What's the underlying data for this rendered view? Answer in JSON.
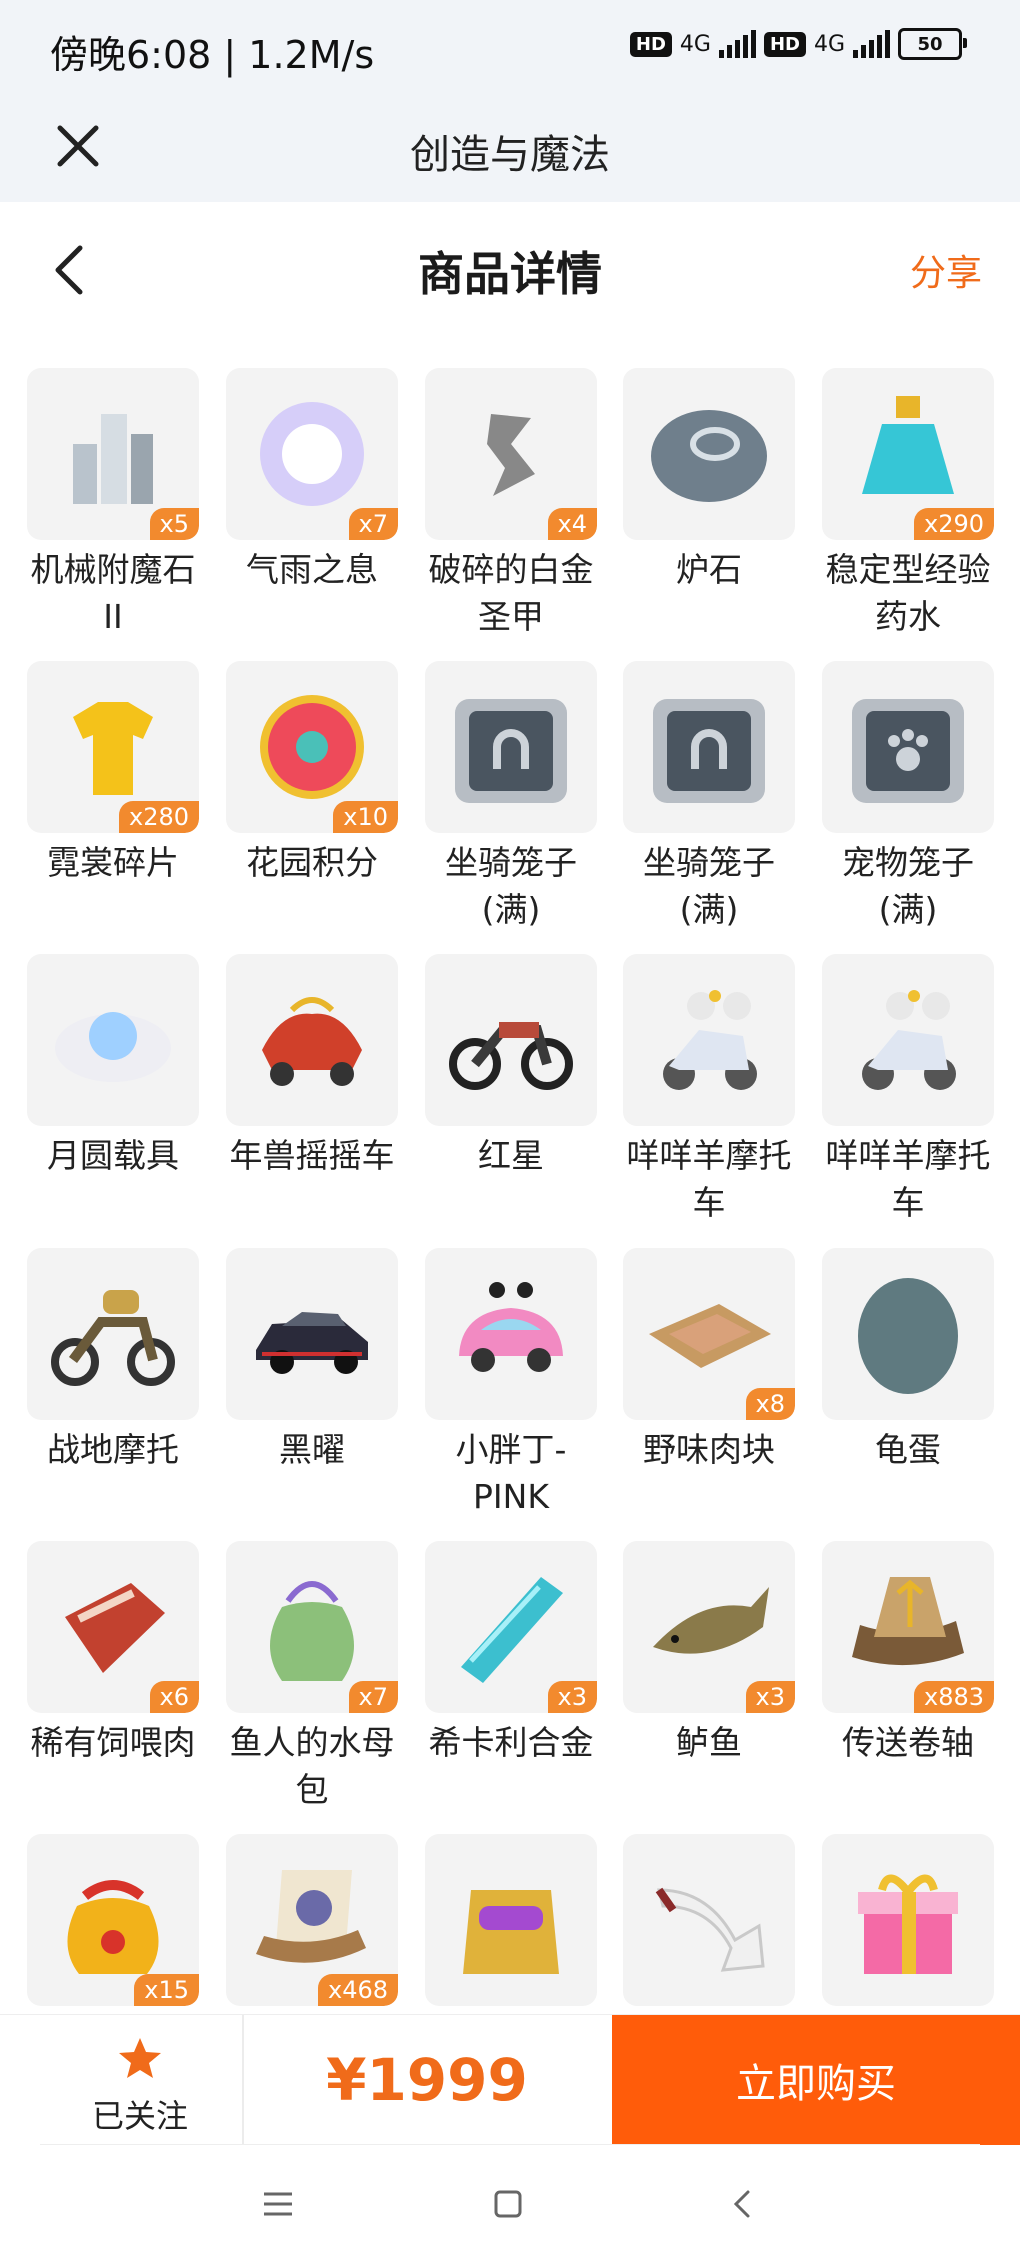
{
  "status": {
    "time": "傍晚6:08 | 1.2M/s",
    "network1": "4G",
    "network2": "4G",
    "battery": "50",
    "hd": "HD"
  },
  "appbar": {
    "title": "创造与魔法"
  },
  "page": {
    "title": "商品详情",
    "share": "分享"
  },
  "items": [
    {
      "name": "机械附魔石II",
      "count": "x5",
      "icon": "crystal-icon",
      "color": "#b9c3cc"
    },
    {
      "name": "气雨之息",
      "count": "x7",
      "icon": "orb-icon",
      "color": "#b9a9ff"
    },
    {
      "name": "破碎的白金圣甲",
      "count": "x4",
      "icon": "fragment-icon",
      "color": "#888888"
    },
    {
      "name": "炉石",
      "count": "",
      "icon": "stone-icon",
      "color": "#6f7f8c"
    },
    {
      "name": "稳定型经验药水",
      "count": "x290",
      "icon": "potion-icon",
      "color": "#36c6d6"
    },
    {
      "name": "霓裳碎片",
      "count": "x280",
      "icon": "shirt-icon",
      "color": "#f4c21a"
    },
    {
      "name": "花园积分",
      "count": "x10",
      "icon": "flower-icon",
      "color": "#ee4a5a"
    },
    {
      "name": "坐骑笼子(满)",
      "count": "",
      "icon": "mount-cage-icon",
      "color": "#4a5560"
    },
    {
      "name": "坐骑笼子(满)",
      "count": "",
      "icon": "mount-cage-icon",
      "color": "#4a5560"
    },
    {
      "name": "宠物笼子(满)",
      "count": "",
      "icon": "pet-cage-icon",
      "color": "#4a5560"
    },
    {
      "name": "月圆载具",
      "count": "",
      "icon": "cloud-moon-icon",
      "color": "#cfe3ff"
    },
    {
      "name": "年兽摇摇车",
      "count": "",
      "icon": "dragon-car-icon",
      "color": "#d0402a"
    },
    {
      "name": "红星",
      "count": "",
      "icon": "motorbike-icon",
      "color": "#3a3a3a"
    },
    {
      "name": "咩咩羊摩托车",
      "count": "",
      "icon": "sheep-scooter-icon",
      "color": "#dfe6f2"
    },
    {
      "name": "咩咩羊摩托车",
      "count": "",
      "icon": "sheep-scooter-icon",
      "color": "#dfe6f2"
    },
    {
      "name": "战地摩托",
      "count": "",
      "icon": "military-bike-icon",
      "color": "#6a5a3a"
    },
    {
      "name": "黑曜",
      "count": "",
      "icon": "black-car-icon",
      "color": "#2a2a3a"
    },
    {
      "name": "小胖丁-PINK",
      "count": "",
      "icon": "pink-car-icon",
      "color": "#f28ac2"
    },
    {
      "name": "野味肉块",
      "count": "x8",
      "icon": "meat-tray-icon",
      "color": "#d9a17a"
    },
    {
      "name": "龟蛋",
      "count": "",
      "icon": "egg-icon",
      "color": "#5f7a80"
    },
    {
      "name": "稀有饲喂肉",
      "count": "x6",
      "icon": "raw-meat-icon",
      "color": "#c2412f"
    },
    {
      "name": "鱼人的水母包",
      "count": "x7",
      "icon": "bag-icon",
      "color": "#8cc07a"
    },
    {
      "name": "希卡利合金",
      "count": "x3",
      "icon": "ingot-icon",
      "color": "#3cbfcf"
    },
    {
      "name": "鲈鱼",
      "count": "x3",
      "icon": "fish-icon",
      "color": "#8a7a4a"
    },
    {
      "name": "传送卷轴",
      "count": "x883",
      "icon": "scroll-icon",
      "color": "#c9a36a"
    },
    {
      "name": "",
      "count": "x15",
      "icon": "lucky-bag-icon",
      "color": "#f2b21a"
    },
    {
      "name": "",
      "count": "x468",
      "icon": "wanted-scroll-icon",
      "color": "#a77a4a"
    },
    {
      "name": "",
      "count": "",
      "icon": "backpack-icon",
      "color": "#e0b23a"
    },
    {
      "name": "",
      "count": "",
      "icon": "horn-icon",
      "color": "#f0f0f0"
    },
    {
      "name": "",
      "count": "",
      "icon": "gift-box-icon",
      "color": "#f46aa6"
    }
  ],
  "bottom": {
    "follow_label": "已关注",
    "price": "¥1999",
    "buy_label": "立即购买"
  }
}
